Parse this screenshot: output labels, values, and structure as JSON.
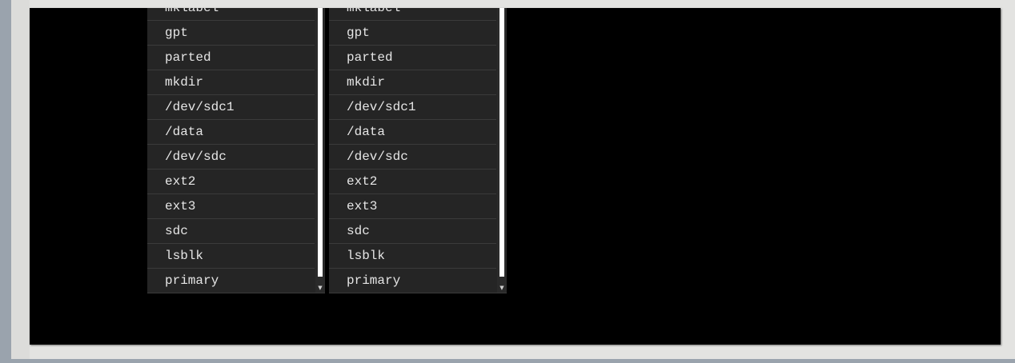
{
  "dropdowns": [
    {
      "items": [
        "mklabel",
        "gpt",
        "parted",
        "mkdir",
        "/dev/sdc1",
        "/data",
        "/dev/sdc",
        "ext2",
        "ext3",
        "sdc",
        "lsblk",
        "primary"
      ],
      "scroll_icon": "triangle-down"
    },
    {
      "items": [
        "mklabel",
        "gpt",
        "parted",
        "mkdir",
        "/dev/sdc1",
        "/data",
        "/dev/sdc",
        "ext2",
        "ext3",
        "sdc",
        "lsblk",
        "primary"
      ],
      "scroll_icon": "triangle-down"
    }
  ],
  "colors": {
    "terminal_background": "#000000",
    "dropdown_background": "#252525",
    "item_text": "#e6e6e6",
    "scroll_thumb": "#ffffff",
    "frame": "#9aa3ad"
  }
}
